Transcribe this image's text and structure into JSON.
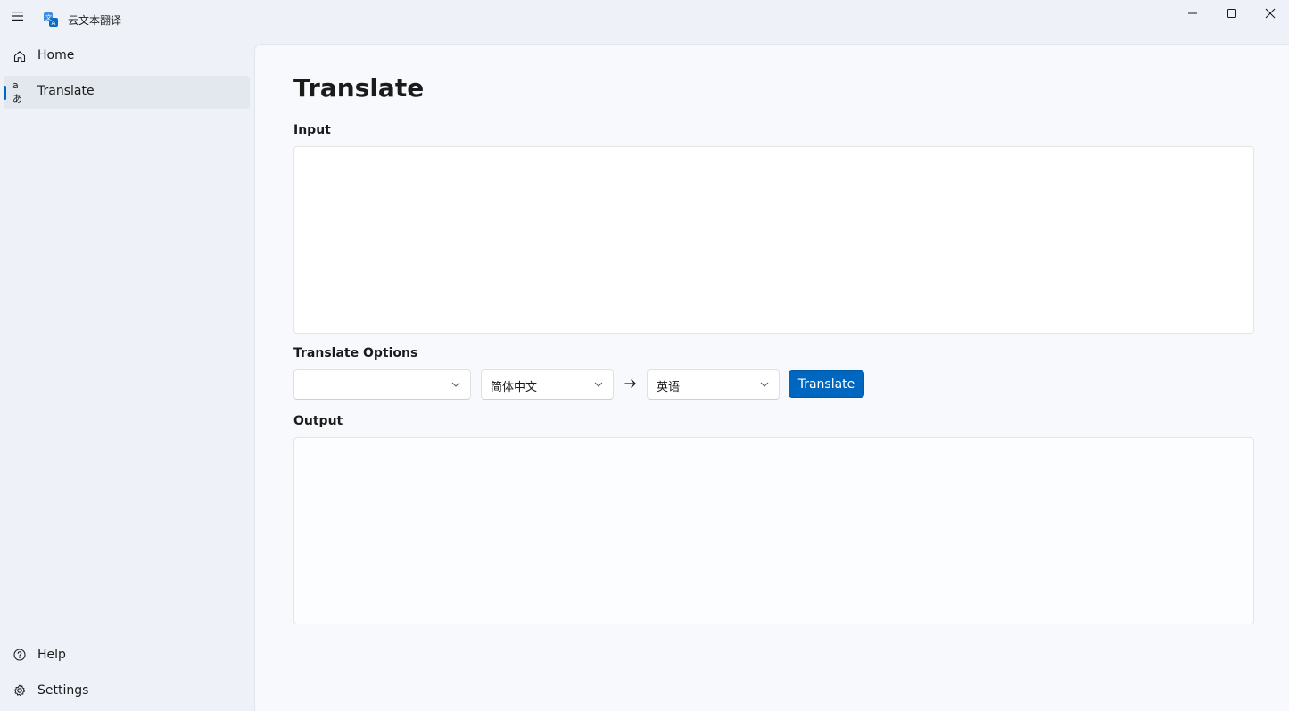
{
  "window": {
    "title": "云文本翻译",
    "icons": {
      "menu": "hamburger-icon",
      "app": "translate-app-icon",
      "minimize": "minimize-icon",
      "maximize": "maximize-icon",
      "close": "close-icon"
    }
  },
  "sidebar": {
    "top_items": [
      {
        "label": "Home",
        "icon": "home-icon",
        "selected": false
      },
      {
        "label": "Translate",
        "icon": "translate-icon",
        "selected": true
      }
    ],
    "bottom_items": [
      {
        "label": "Help",
        "icon": "help-icon"
      },
      {
        "label": "Settings",
        "icon": "gear-icon"
      }
    ],
    "translate_glyph": "aあ"
  },
  "page": {
    "title": "Translate",
    "input_label": "Input",
    "input_value": "",
    "options_label": "Translate Options",
    "engine_value": "",
    "source_language": "简体中文",
    "target_language": "英语",
    "translate_button": "Translate",
    "output_label": "Output",
    "output_value": ""
  },
  "colors": {
    "accent": "#0067c0",
    "background": "#eef2f8",
    "content": "#f7f9fc",
    "selected_nav": "#e3e8ef"
  }
}
